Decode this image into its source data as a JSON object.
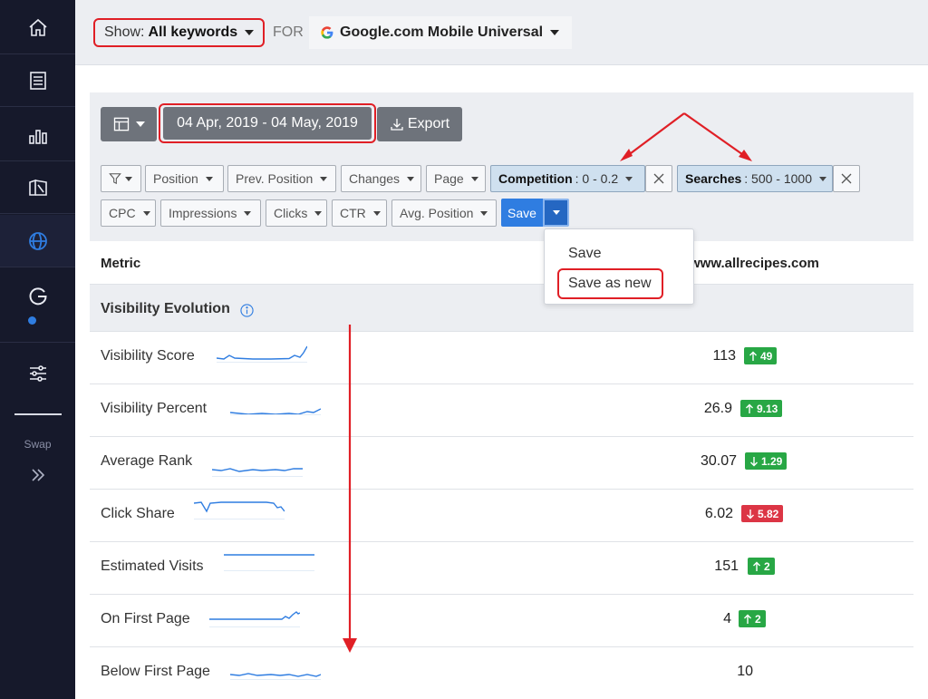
{
  "sidebar": {
    "items": [
      {
        "icon": "home-icon"
      },
      {
        "icon": "document-icon"
      },
      {
        "icon": "bar-chart-icon"
      },
      {
        "icon": "map-icon"
      },
      {
        "icon": "globe-icon",
        "active": true
      },
      {
        "icon": "google-icon"
      },
      {
        "icon": "sliders-icon"
      }
    ],
    "swap_label": "Swap"
  },
  "topbar": {
    "show_label": "Show:",
    "show_value": "All keywords",
    "for_label": "FOR",
    "engine": "Google.com Mobile Universal"
  },
  "toolbar": {
    "date_range": "04 Apr, 2019 - 04 May, 2019",
    "export_label": "Export"
  },
  "filters": {
    "row1": [
      "Position",
      "Prev. Position",
      "Changes",
      "Page"
    ],
    "competition": {
      "label": "Competition",
      "value": ": 0 - 0.2"
    },
    "searches": {
      "label": "Searches",
      "value": ": 500 - 1000"
    },
    "row2": [
      "CPC",
      "Impressions",
      "Clicks",
      "CTR",
      "Avg. Position"
    ],
    "save_label": "Save"
  },
  "dropdown": {
    "save": "Save",
    "save_as_new": "Save as new"
  },
  "table": {
    "header_metric": "Metric",
    "header_site": "www.allrecipes.com",
    "section_title": "Visibility Evolution",
    "rows": [
      {
        "name": "Visibility Score",
        "value": "113",
        "change": "49",
        "direction": "up",
        "tone": "good"
      },
      {
        "name": "Visibility Percent",
        "value": "26.9",
        "change": "9.13",
        "direction": "up",
        "tone": "good"
      },
      {
        "name": "Average Rank",
        "value": "30.07",
        "change": "1.29",
        "direction": "down",
        "tone": "good"
      },
      {
        "name": "Click Share",
        "value": "6.02",
        "change": "5.82",
        "direction": "down",
        "tone": "bad"
      },
      {
        "name": "Estimated Visits",
        "value": "151",
        "change": "2",
        "direction": "up",
        "tone": "good"
      },
      {
        "name": "On First Page",
        "value": "4",
        "change": "2",
        "direction": "up",
        "tone": "good"
      },
      {
        "name": "Below First Page",
        "value": "10",
        "change": "",
        "direction": "",
        "tone": ""
      }
    ]
  },
  "colors": {
    "sidebar_bg": "#16192b",
    "accent_blue": "#2f7de1",
    "badge_green": "#28a745",
    "badge_red": "#dc3545",
    "annotation_red": "#e01f26"
  }
}
